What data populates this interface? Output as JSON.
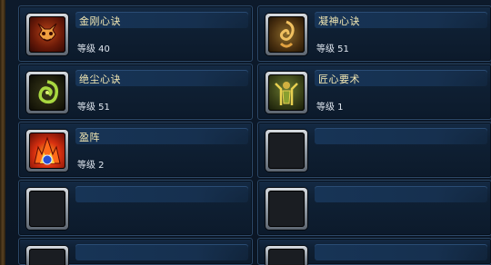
{
  "skills": [
    {
      "name": "金刚心诀",
      "level": "等级 40",
      "icon": "demon-face-icon"
    },
    {
      "name": "凝神心诀",
      "level": "等级 51",
      "icon": "spiral-sigil-icon"
    },
    {
      "name": "绝尘心诀",
      "level": "等级 51",
      "icon": "green-swirl-icon"
    },
    {
      "name": "匠心要术",
      "level": "等级 1",
      "icon": "craftsman-figure-icon"
    },
    {
      "name": "盈阵",
      "level": "等级 2",
      "icon": "flame-formation-icon"
    }
  ],
  "colors": {
    "name_text": "#f3e8b3",
    "level_text": "#dfe6ef",
    "card_border": "#2c4868"
  }
}
